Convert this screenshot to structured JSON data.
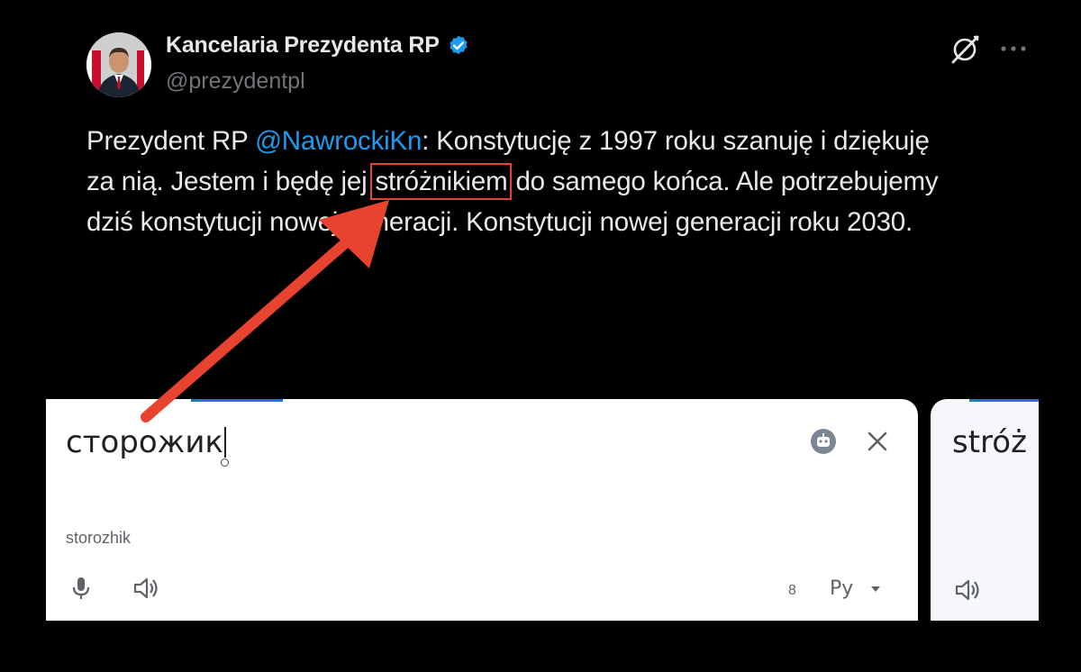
{
  "tweet": {
    "display_name": "Kancelaria Prezydenta RP",
    "handle": "@prezydentpl",
    "text_line1_before": "Prezydent RP ",
    "mention": "@NawrockiKn",
    "text_line1_after": ": Konstytucję z 1997 roku szanuję i dziękuję",
    "text_line2_before": "za nią. Jestem i będę jej ",
    "highlighted_word": "stróżnikiem",
    "text_line2_after": " do samego końca. Ale potrzebujemy",
    "text_line3": "dziś konstytucji nowej generacji. Konstytucji nowej generacji roku 2030.",
    "verified_badge": "verified-badge-icon",
    "grok_icon": "grok-icon",
    "more_icon": "more-horizontal-icon"
  },
  "annotation": {
    "box_color": "#e8432e",
    "arrow_color": "#e8432e"
  },
  "translate": {
    "source_text": "сторожик",
    "romanization": "storozhik",
    "char_count": "8",
    "keyboard_label": "Pу",
    "target_text": "stróż",
    "accent_color": "#1a73e8"
  }
}
